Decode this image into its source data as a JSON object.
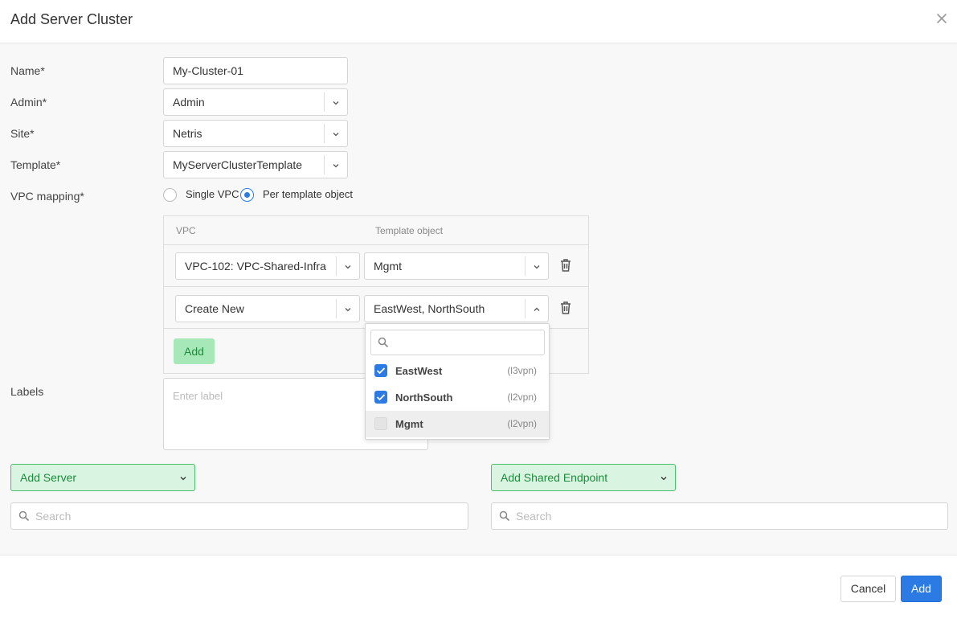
{
  "dialog": {
    "title": "Add Server Cluster"
  },
  "form": {
    "name_label": "Name*",
    "name_value": "My-Cluster-01",
    "admin_label": "Admin*",
    "admin_value": "Admin",
    "site_label": "Site*",
    "site_value": "Netris",
    "template_label": "Template*",
    "template_value": "MyServerClusterTemplate",
    "vpc_mapping_label": "VPC mapping*",
    "vpc_mapping_options": [
      {
        "label": "Single VPC",
        "selected": false
      },
      {
        "label": "Per template object",
        "selected": true
      }
    ],
    "labels_label": "Labels",
    "labels_placeholder": "Enter label"
  },
  "vpc_table": {
    "columns": [
      "VPC",
      "Template object"
    ],
    "rows": [
      {
        "vpc": "VPC-102: VPC-Shared-Infra",
        "template_object": "Mgmt"
      },
      {
        "vpc": "Create New",
        "template_object": "EastWest, NorthSouth"
      }
    ],
    "add_label": "Add"
  },
  "dropdown": {
    "search_placeholder": "",
    "options": [
      {
        "name": "EastWest",
        "type": "(l3vpn)",
        "checked": true
      },
      {
        "name": "NorthSouth",
        "type": "(l2vpn)",
        "checked": true
      },
      {
        "name": "Mgmt",
        "type": "(l2vpn)",
        "checked": false
      }
    ]
  },
  "servers": {
    "add_label": "Add Server",
    "search_placeholder": "Search"
  },
  "endpoints": {
    "add_label": "Add Shared Endpoint",
    "search_placeholder": "Search"
  },
  "footer": {
    "cancel_label": "Cancel",
    "add_label": "Add"
  },
  "colors": {
    "primary": "#2c7be5",
    "success_bg": "#d9f5e1",
    "success_text": "#1f8a3d"
  }
}
